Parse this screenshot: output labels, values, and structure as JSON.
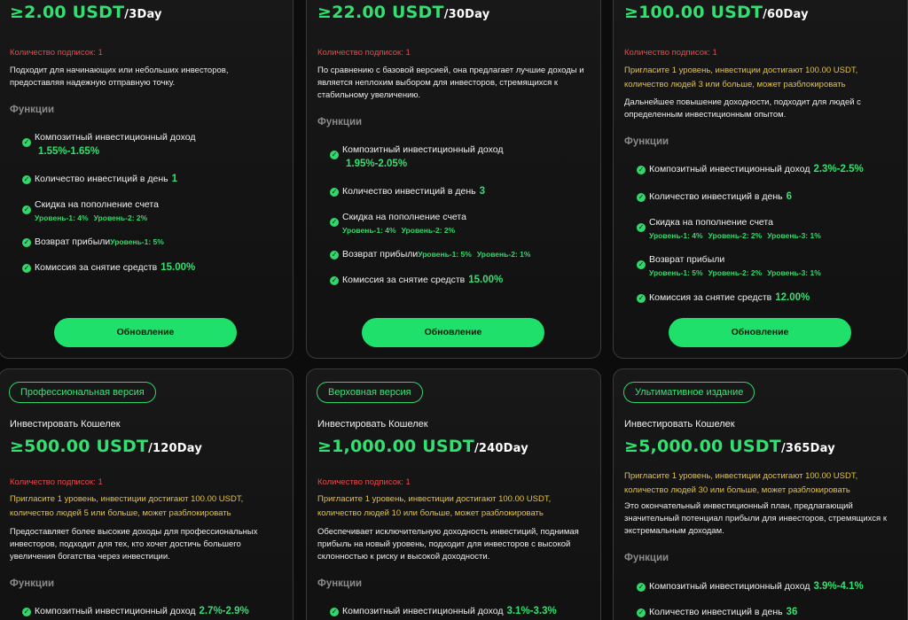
{
  "common": {
    "subs_label": "Количество подписок: 1",
    "functions_label": "Функции",
    "upgrade_label": "Обновление",
    "wallet_label": "Инвестировать Кошелек",
    "ge": "≥",
    "check": "✓"
  },
  "colors": {
    "accent": "#31e070",
    "button": "#1fe06a",
    "warn": "#e84a4a",
    "invite": "#e7c23a"
  },
  "plans": [
    {
      "price": "2.00 USDT",
      "period": "/3Day",
      "description": "Подходит для начинающих или небольших инвесторов, предоставляя надежную отправную точку.",
      "features": {
        "income_label": "Композитный инвестиционный доход",
        "income_value": "1.55%-1.65%",
        "daily_label": "Количество инвестиций в день",
        "daily_value": "1",
        "discount_label": "Скидка на пополнение счета",
        "discount_levels": [
          "Уровень-1: 4%",
          "Уровень-2: 2%"
        ],
        "rebate_label": "Возврат прибыли",
        "rebate_levels": [
          "Уровень-1: 5%"
        ],
        "fee_label": "Комиссия за снятие средств",
        "fee_value": "15.00%"
      }
    },
    {
      "price": "22.00 USDT",
      "period": "/30Day",
      "description": "По сравнению с базовой версией, она предлагает лучшие доходы и является неплохим выбором для инвесторов, стремящихся к стабильному увеличению.",
      "features": {
        "income_label": "Композитный инвестиционный доход",
        "income_value": "1.95%-2.05%",
        "daily_label": "Количество инвестиций в день",
        "daily_value": "3",
        "discount_label": "Скидка на пополнение счета",
        "discount_levels": [
          "Уровень-1: 4%",
          "Уровень-2: 2%"
        ],
        "rebate_label": "Возврат прибыли",
        "rebate_levels": [
          "Уровень-1: 5%",
          "Уровень-2: 1%"
        ],
        "fee_label": "Комиссия за снятие средств",
        "fee_value": "15.00%"
      }
    },
    {
      "price": "100.00 USDT",
      "period": "/60Day",
      "invite": "Пригласите 1 уровень, инвестиции достигают 100.00 USDT, количество людей 3 или больше, может разблокировать",
      "description": "Дальнейшее повышение доходности, подходит для людей с определенным инвестиционным опытом.",
      "features": {
        "income_label": "Композитный инвестиционный доход",
        "income_value": "2.3%-2.5%",
        "daily_label": "Количество инвестиций в день",
        "daily_value": "6",
        "discount_label": "Скидка на пополнение счета",
        "discount_levels": [
          "Уровень-1: 4%",
          "Уровень-2: 2%",
          "Уровень-3: 1%"
        ],
        "rebate_label": "Возврат прибыли",
        "rebate_levels": [
          "Уровень-1: 5%",
          "Уровень-2: 2%",
          "Уровень-3: 1%"
        ],
        "fee_label": "Комиссия за снятие средств",
        "fee_value": "12.00%"
      }
    },
    {
      "badge": "Профессиональная версия",
      "price": "500.00 USDT",
      "period": "/120Day",
      "invite": "Пригласите 1 уровень, инвестиции достигают 100.00 USDT, количество людей 5 или больше, может разблокировать",
      "description": "Предоставляет более высокие доходы для профессиональных инвесторов, подходит для тех, кто хочет достичь большего увеличения богатства через инвестиции.",
      "features": {
        "income_label": "Композитный инвестиционный доход",
        "income_value": "2.7%-2.9%"
      }
    },
    {
      "badge": "Верховная версия",
      "price": "1,000.00 USDT",
      "period": "/240Day",
      "invite": "Пригласите 1 уровень, инвестиции достигают 100.00 USDT, количество людей 10 или больше, может разблокировать",
      "description": "Обеспечивает исключительную доходность инвестиций, поднимая прибыль на новый уровень, подходит для инвесторов с высокой склонностью к риску и высокой доходности.",
      "features": {
        "income_label": "Композитный инвестиционный доход",
        "income_value": "3.1%-3.3%"
      }
    },
    {
      "badge": "Ультимативное издание",
      "price": "5,000.00 USDT",
      "period": "/365Day",
      "invite": "Пригласите 1 уровень, инвестиции достигают 100.00 USDT, количество людей 30 или больше, может разблокировать",
      "description": "Это окончательный инвестиционный план, предлагающий значительный потенциал прибыли для инвесторов, стремящихся к экстремальным доходам.",
      "features": {
        "income_label": "Композитный инвестиционный доход",
        "income_value": "3.9%-4.1%",
        "daily_label": "Количество инвестиций в день",
        "daily_value": "36"
      }
    }
  ]
}
